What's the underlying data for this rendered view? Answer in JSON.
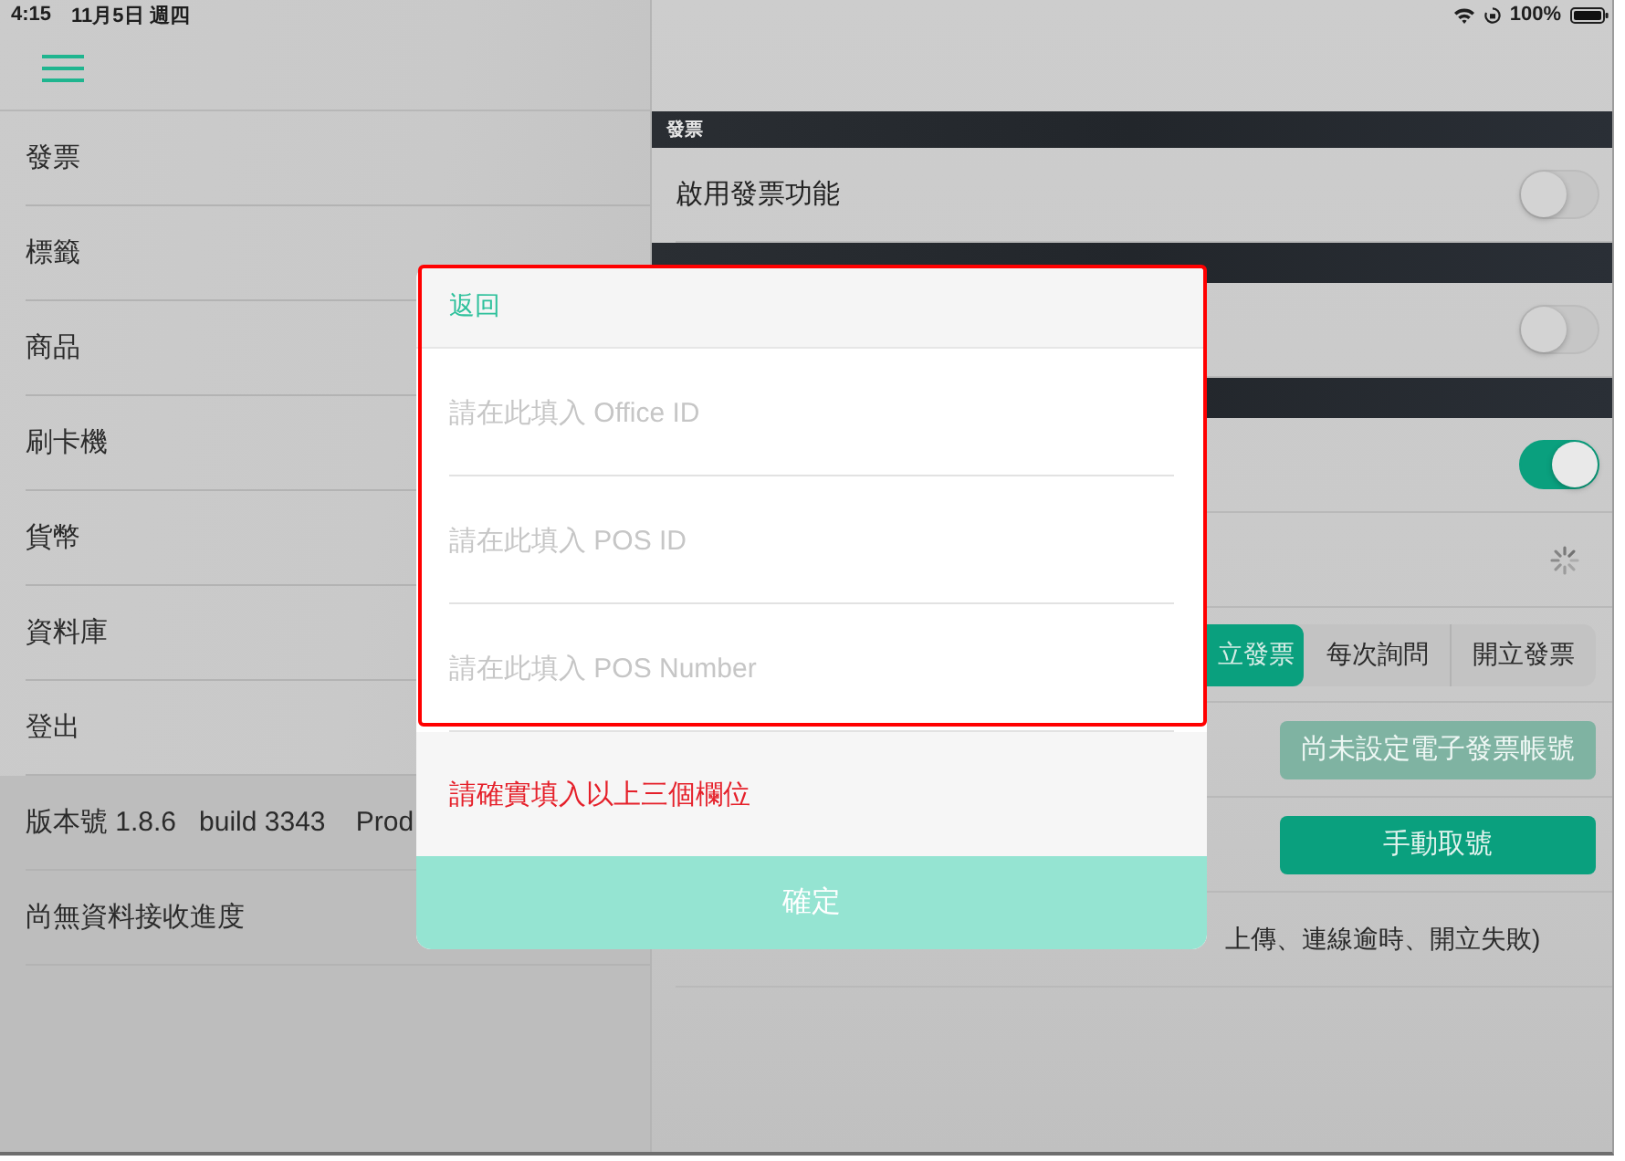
{
  "status_bar": {
    "time": "4:15",
    "date": "11月5日 週四",
    "battery": "100%"
  },
  "sidebar": {
    "items": [
      {
        "label": "發票"
      },
      {
        "label": "標籤"
      },
      {
        "label": "商品"
      },
      {
        "label": "刷卡機"
      },
      {
        "label": "貨幣"
      },
      {
        "label": "資料庫"
      },
      {
        "label": "登出"
      }
    ],
    "footer": [
      {
        "text": "版本號 1.8.6   build 3343    Prod"
      },
      {
        "text": "尚無資料接收進度"
      }
    ]
  },
  "settings": {
    "sections": [
      {
        "header": "發票",
        "rows": [
          {
            "kind": "toggle",
            "label": "啟用發票功能",
            "on": false
          }
        ]
      },
      {
        "rows": [
          {
            "kind": "toggle",
            "on": false
          }
        ]
      },
      {
        "rows": [
          {
            "kind": "toggle",
            "on": true
          },
          {
            "kind": "spinner"
          },
          {
            "kind": "segmented",
            "options": [
              {
                "label": "立發票",
                "selected": true
              },
              {
                "label": "每次詢問",
                "selected": false
              },
              {
                "label": "開立發票",
                "selected": false
              }
            ]
          },
          {
            "kind": "button",
            "label": "尚未設定電子發票帳號",
            "disabled": true
          },
          {
            "kind": "button",
            "label": "手動取號",
            "disabled": false
          },
          {
            "kind": "text",
            "text": "上傳、連線逾時、開立失敗)"
          }
        ]
      }
    ]
  },
  "dialog": {
    "back": "返回",
    "fields": [
      {
        "placeholder": "請在此填入 Office ID"
      },
      {
        "placeholder": "請在此填入 POS ID"
      },
      {
        "placeholder": "請在此填入 POS Number"
      }
    ],
    "error": "請確實填入以上三個欄位",
    "confirm": "確定"
  }
}
